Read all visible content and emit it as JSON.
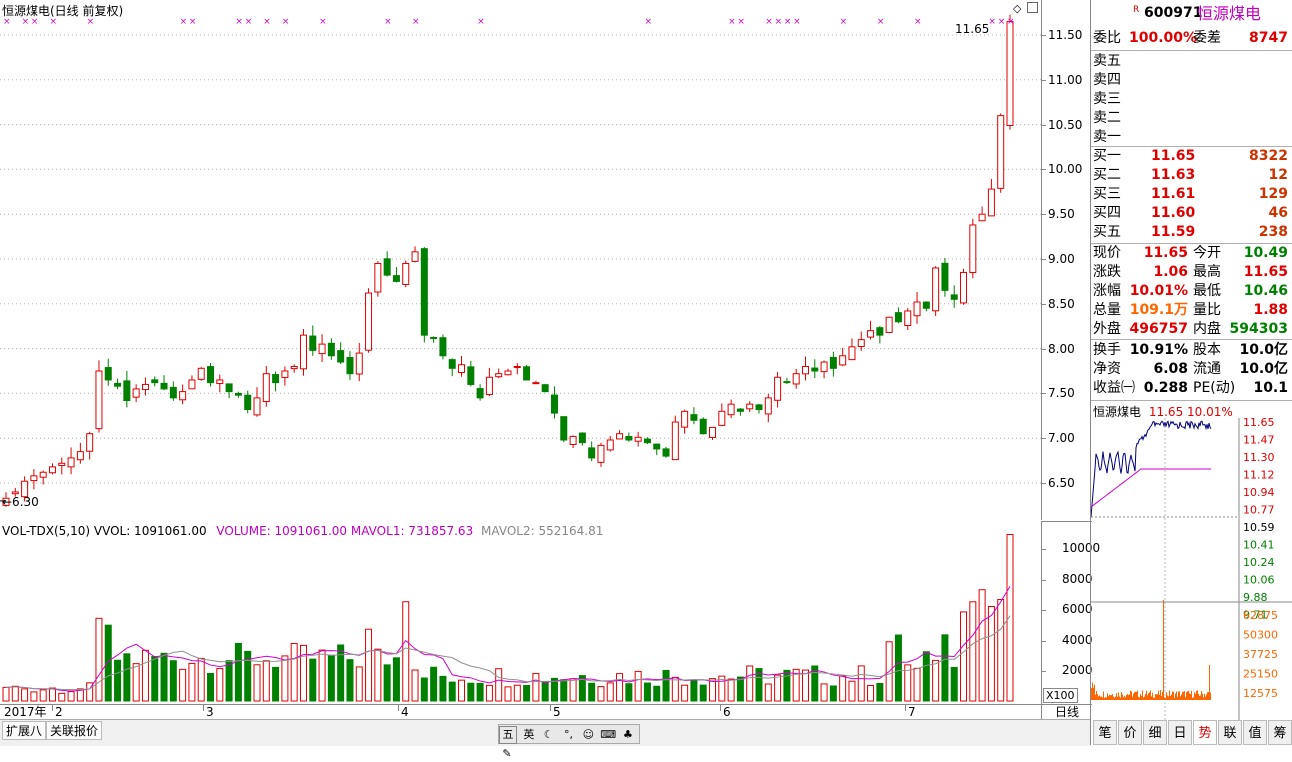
{
  "header": {
    "title": "恒源煤电(日线 前复权)",
    "high_label": "11.65",
    "low_label": "←6.30"
  },
  "price_axis": [
    "11.50",
    "11.00",
    "10.50",
    "10.00",
    "9.50",
    "9.00",
    "8.50",
    "8.00",
    "7.50",
    "7.00",
    "6.50"
  ],
  "volume_header": {
    "indicator": "VOL-TDX(5,10)",
    "vvol": "VVOL: 1091061.00",
    "volume": "VOLUME: 1091061.00",
    "mavol1": "MAVOL1: 731857.63",
    "mavol2": "MAVOL2: 552164.81"
  },
  "volume_axis": [
    "10000",
    "8000",
    "6000",
    "4000",
    "2000"
  ],
  "volume_unit": "X100",
  "date_axis": [
    "2017年",
    "2",
    "3",
    "4",
    "5",
    "6",
    "7"
  ],
  "period_label": "日线",
  "bottom_tabs": [
    "扩展八",
    "关联报价"
  ],
  "toolbar_icons": [
    "五",
    "英"
  ],
  "side_tabs": [
    "笔",
    "价",
    "细",
    "日",
    "势",
    "联",
    "值",
    "筹"
  ],
  "quote": {
    "r_badge": "R",
    "code": "600971",
    "name": "恒源煤电",
    "weibi_label": "委比",
    "weibi_value": "100.00%",
    "weicha_label": "委差",
    "weicha_value": "8747",
    "asks": [
      {
        "label": "卖五",
        "price": "",
        "vol": ""
      },
      {
        "label": "卖四",
        "price": "",
        "vol": ""
      },
      {
        "label": "卖三",
        "price": "",
        "vol": ""
      },
      {
        "label": "卖二",
        "price": "",
        "vol": ""
      },
      {
        "label": "卖一",
        "price": "",
        "vol": ""
      }
    ],
    "bids": [
      {
        "label": "买一",
        "price": "11.65",
        "vol": "8322"
      },
      {
        "label": "买二",
        "price": "11.63",
        "vol": "12"
      },
      {
        "label": "买三",
        "price": "11.61",
        "vol": "129"
      },
      {
        "label": "买四",
        "price": "11.60",
        "vol": "46"
      },
      {
        "label": "买五",
        "price": "11.59",
        "vol": "238"
      }
    ],
    "stats": [
      {
        "l1": "现价",
        "v1": "11.65",
        "c1": "red",
        "l2": "今开",
        "v2": "10.49",
        "c2": "green"
      },
      {
        "l1": "涨跌",
        "v1": "1.06",
        "c1": "red",
        "l2": "最高",
        "v2": "11.65",
        "c2": "red"
      },
      {
        "l1": "涨幅",
        "v1": "10.01%",
        "c1": "red",
        "l2": "最低",
        "v2": "10.46",
        "c2": "green"
      },
      {
        "l1": "总量",
        "v1": "109.1万",
        "c1": "orange",
        "l2": "量比",
        "v2": "1.88",
        "c2": "red"
      },
      {
        "l1": "外盘",
        "v1": "496757",
        "c1": "red",
        "l2": "内盘",
        "v2": "594303",
        "c2": "green"
      }
    ],
    "fund": [
      {
        "l1": "换手",
        "v1": "10.91%",
        "l2": "股本",
        "v2": "10.0亿"
      },
      {
        "l1": "净资",
        "v1": "6.08",
        "l2": "流通",
        "v2": "10.0亿"
      },
      {
        "l1": "收益㈠",
        "v1": "0.288",
        "l2": "PE(动)",
        "v2": "10.1"
      }
    ]
  },
  "mini": {
    "name": "恒源煤电",
    "price": "11.65",
    "pct": "10.01%",
    "right_axis": [
      "11.65",
      "11.47",
      "11.30",
      "11.12",
      "10.94",
      "10.77",
      "10.59",
      "10.41",
      "10.24",
      "10.06",
      "9.88",
      "9.71"
    ],
    "vol_axis": [
      "62875",
      "50300",
      "37725",
      "25150",
      "12575"
    ]
  },
  "colors": {
    "up": "#e00000",
    "down": "#008000",
    "ma1": "#d000d0",
    "ma2": "#909090"
  }
}
